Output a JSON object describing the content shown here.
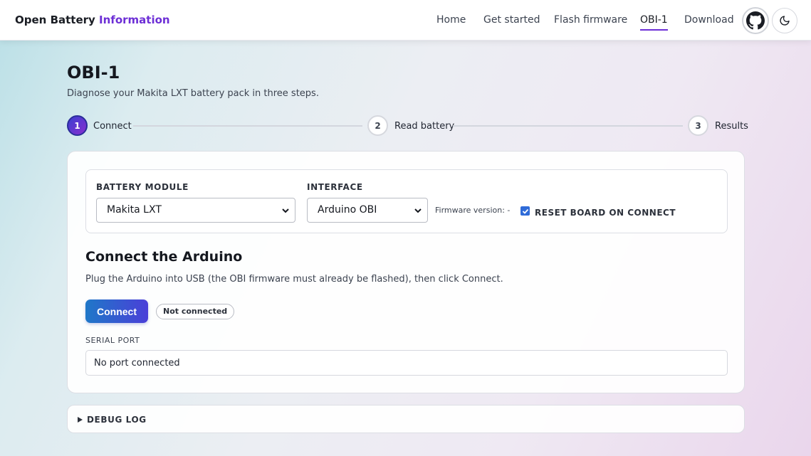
{
  "header": {
    "brand_main": "Open Battery",
    "brand_accent": "Information",
    "nav": [
      {
        "label": "Home",
        "active": false
      },
      {
        "label": "Get started",
        "active": false
      },
      {
        "label": "Flash firmware",
        "active": false
      },
      {
        "label": "OBI-1",
        "active": true
      },
      {
        "label": "Download",
        "active": false
      }
    ],
    "icons": {
      "github": "github-icon",
      "theme": "moon-icon"
    }
  },
  "page": {
    "title": "OBI-1",
    "subtitle": "Diagnose your Makita LXT battery pack in three steps."
  },
  "steps": [
    {
      "number": "1",
      "label": "Connect",
      "active": true
    },
    {
      "number": "2",
      "label": "Read battery",
      "active": false
    },
    {
      "number": "3",
      "label": "Results",
      "active": false
    }
  ],
  "settings": {
    "battery_module_label": "BATTERY MODULE",
    "battery_module_value": "Makita LXT",
    "interface_label": "INTERFACE",
    "interface_value": "Arduino OBI",
    "firmware_version": "Firmware version: -",
    "reset_checkbox_label": "RESET BOARD ON CONNECT",
    "reset_checked": true
  },
  "connect": {
    "title": "Connect the Arduino",
    "description": "Plug the Arduino into USB (the OBI firmware must already be flashed), then click Connect.",
    "button_label": "Connect",
    "status": "Not connected",
    "serial_port_label": "SERIAL PORT",
    "serial_port_value": "No port connected"
  },
  "debug": {
    "label": "DEBUG LOG"
  },
  "colors": {
    "accent": "#6d2fd6",
    "button_start": "#1f78c8",
    "button_end": "#4a3fd8"
  }
}
